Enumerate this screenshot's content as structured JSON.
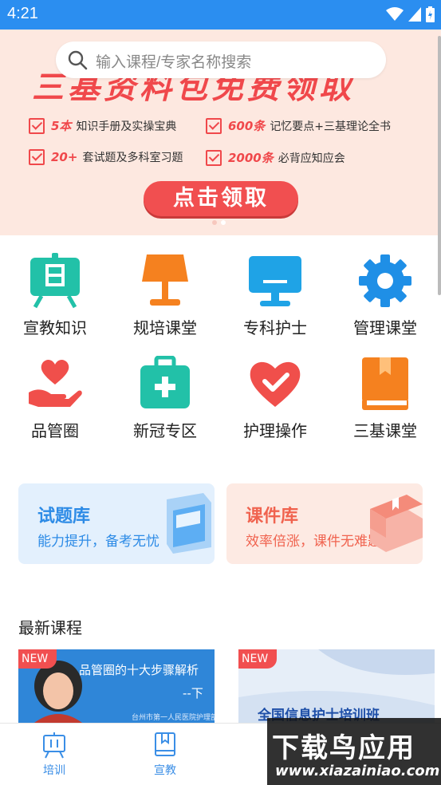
{
  "status_bar": {
    "time": "4:21"
  },
  "search": {
    "placeholder": "输入课程/专家名称搜索"
  },
  "banner": {
    "headline": "三基资料包免费领取",
    "features": [
      {
        "num": "5本",
        "text": "知识手册及实操宝典"
      },
      {
        "num": "600条",
        "text": "记忆要点+三基理论全书"
      },
      {
        "num": "20+",
        "text": "套试题及多科室习题"
      },
      {
        "num": "2000条",
        "text": "必背应知应会"
      }
    ],
    "cta": "点击领取"
  },
  "grid": [
    {
      "label": "宣教知识",
      "icon": "easel-icon",
      "color": "#22c1a8"
    },
    {
      "label": "规培课堂",
      "icon": "lamp-icon",
      "color": "#f5811f"
    },
    {
      "label": "专科护士",
      "icon": "monitor-icon",
      "color": "#1fa3e6"
    },
    {
      "label": "管理课堂",
      "icon": "gear-icon",
      "color": "#1f8fe6"
    },
    {
      "label": "品管圈",
      "icon": "heart-hand-icon",
      "color": "#f04f4b"
    },
    {
      "label": "新冠专区",
      "icon": "medkit-icon",
      "color": "#22c1a8"
    },
    {
      "label": "护理操作",
      "icon": "heart-check-icon",
      "color": "#f04f4b"
    },
    {
      "label": "三基课堂",
      "icon": "book-icon",
      "color": "#f5811f"
    }
  ],
  "cards": [
    {
      "title": "试题库",
      "subtitle": "能力提升，备考无忧"
    },
    {
      "title": "课件库",
      "subtitle": "效率倍涨，课件无难题"
    }
  ],
  "section": {
    "title": "最新课程"
  },
  "courses": [
    {
      "tag": "NEW",
      "title": "品管圈的十大步骤解析",
      "suffix": "--下",
      "caption": "台州市第一人民医院护理部副主任"
    },
    {
      "tag": "NEW",
      "title": "全国信息护士培训班"
    }
  ],
  "bottom_nav": [
    {
      "label": "培训",
      "icon": "easel-icon"
    },
    {
      "label": "宣教",
      "icon": "book-icon"
    }
  ],
  "watermark": {
    "big": "下载鸟应用",
    "small": "www.xiazainiao.com"
  },
  "colors": {
    "primary": "#2b8ef0",
    "accent": "#f0484b",
    "banner_bg": "#fde8e0"
  }
}
